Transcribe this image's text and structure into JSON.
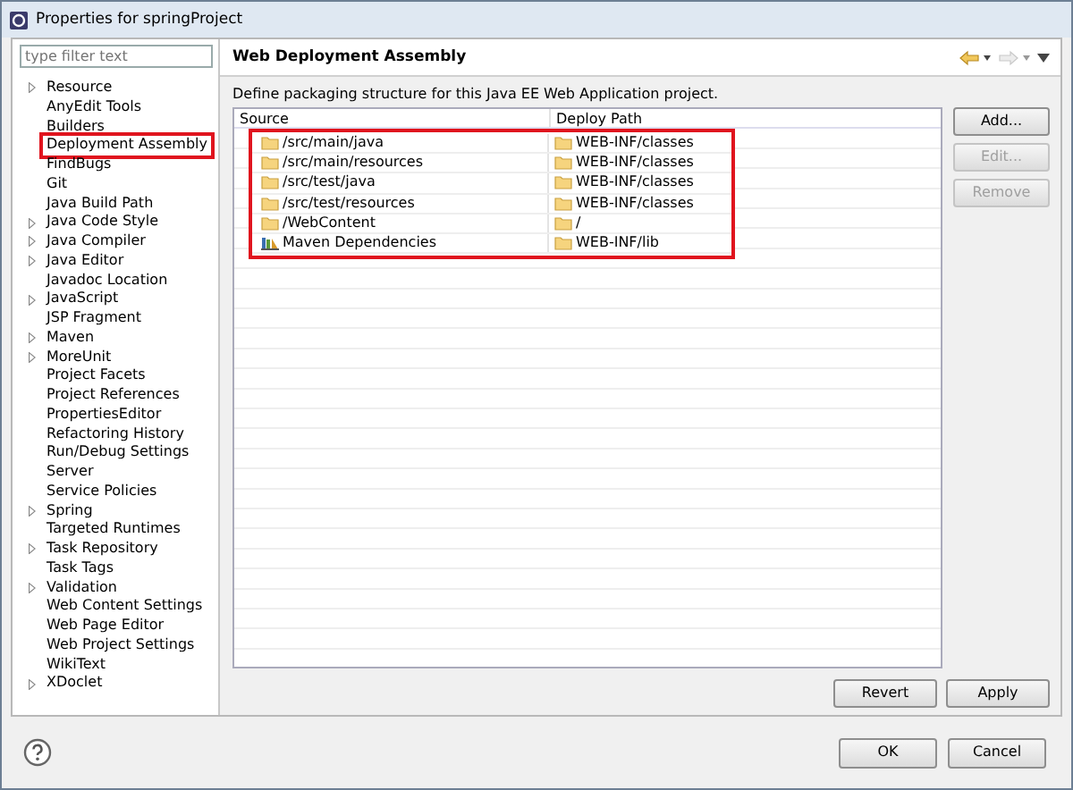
{
  "window": {
    "title": "Properties for springProject"
  },
  "filter": {
    "placeholder": "type filter text"
  },
  "sidebar": {
    "items": [
      {
        "label": "Resource",
        "expandable": true,
        "selected": false
      },
      {
        "label": "AnyEdit Tools",
        "expandable": false,
        "selected": false
      },
      {
        "label": "Builders",
        "expandable": false,
        "selected": false
      },
      {
        "label": "Deployment Assembly",
        "expandable": false,
        "selected": true
      },
      {
        "label": "FindBugs",
        "expandable": false,
        "selected": false
      },
      {
        "label": "Git",
        "expandable": false,
        "selected": false
      },
      {
        "label": "Java Build Path",
        "expandable": false,
        "selected": false
      },
      {
        "label": "Java Code Style",
        "expandable": true,
        "selected": false
      },
      {
        "label": "Java Compiler",
        "expandable": true,
        "selected": false
      },
      {
        "label": "Java Editor",
        "expandable": true,
        "selected": false
      },
      {
        "label": "Javadoc Location",
        "expandable": false,
        "selected": false
      },
      {
        "label": "JavaScript",
        "expandable": true,
        "selected": false
      },
      {
        "label": "JSP Fragment",
        "expandable": false,
        "selected": false
      },
      {
        "label": "Maven",
        "expandable": true,
        "selected": false
      },
      {
        "label": "MoreUnit",
        "expandable": true,
        "selected": false
      },
      {
        "label": "Project Facets",
        "expandable": false,
        "selected": false
      },
      {
        "label": "Project References",
        "expandable": false,
        "selected": false
      },
      {
        "label": "PropertiesEditor",
        "expandable": false,
        "selected": false
      },
      {
        "label": "Refactoring History",
        "expandable": false,
        "selected": false
      },
      {
        "label": "Run/Debug Settings",
        "expandable": false,
        "selected": false
      },
      {
        "label": "Server",
        "expandable": false,
        "selected": false
      },
      {
        "label": "Service Policies",
        "expandable": false,
        "selected": false
      },
      {
        "label": "Spring",
        "expandable": true,
        "selected": false
      },
      {
        "label": "Targeted Runtimes",
        "expandable": false,
        "selected": false
      },
      {
        "label": "Task Repository",
        "expandable": true,
        "selected": false
      },
      {
        "label": "Task Tags",
        "expandable": false,
        "selected": false
      },
      {
        "label": "Validation",
        "expandable": true,
        "selected": false
      },
      {
        "label": "Web Content Settings",
        "expandable": false,
        "selected": false
      },
      {
        "label": "Web Page Editor",
        "expandable": false,
        "selected": false
      },
      {
        "label": "Web Project Settings",
        "expandable": false,
        "selected": false
      },
      {
        "label": "WikiText",
        "expandable": false,
        "selected": false
      },
      {
        "label": "XDoclet",
        "expandable": true,
        "selected": false
      }
    ]
  },
  "page": {
    "title": "Web Deployment Assembly",
    "description": "Define packaging structure for this Java EE Web Application project."
  },
  "table": {
    "columns": [
      "Source",
      "Deploy Path"
    ],
    "highlighted": true,
    "rows": [
      {
        "kind": "folder",
        "source": "/src/main/java",
        "deploy_path": "WEB-INF/classes"
      },
      {
        "kind": "folder",
        "source": "/src/main/resources",
        "deploy_path": "WEB-INF/classes"
      },
      {
        "kind": "folder",
        "source": "/src/test/java",
        "deploy_path": "WEB-INF/classes"
      },
      {
        "kind": "folder",
        "source": "/src/test/resources",
        "deploy_path": "WEB-INF/classes"
      },
      {
        "kind": "folder",
        "source": "/WebContent",
        "deploy_path": "/"
      },
      {
        "kind": "library",
        "source": "Maven Dependencies",
        "deploy_path": "WEB-INF/lib"
      }
    ]
  },
  "side_buttons": [
    {
      "label": "Add...",
      "disabled": false
    },
    {
      "label": "Edit...",
      "disabled": true
    },
    {
      "label": "Remove",
      "disabled": true
    }
  ],
  "page_buttons": [
    "Revert",
    "Apply"
  ],
  "dialog_buttons": [
    "OK",
    "Cancel"
  ]
}
